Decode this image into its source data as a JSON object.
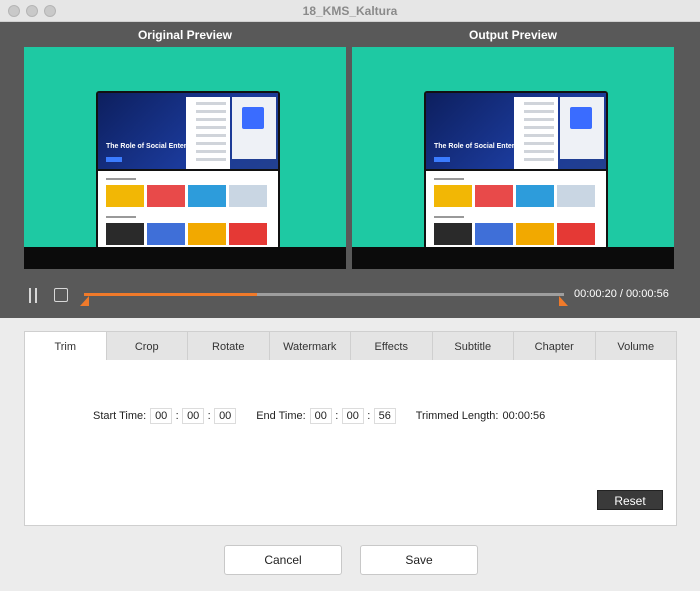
{
  "window": {
    "title": "18_KMS_Kaltura"
  },
  "preview": {
    "original_title": "Original Preview",
    "output_title": "Output  Preview",
    "video_headline": "The Role of Social Enterprise"
  },
  "playback": {
    "timecode": "00:00:20 / 00:00:56",
    "progress": 0.36
  },
  "tabs": [
    {
      "label": "Trim",
      "active": true
    },
    {
      "label": "Crop"
    },
    {
      "label": "Rotate"
    },
    {
      "label": "Watermark"
    },
    {
      "label": "Effects"
    },
    {
      "label": "Subtitle"
    },
    {
      "label": "Chapter"
    },
    {
      "label": "Volume"
    }
  ],
  "trim": {
    "start_label": "Start Time:",
    "start": [
      "00",
      "00",
      "00"
    ],
    "end_label": "End Time:",
    "end": [
      "00",
      "00",
      "56"
    ],
    "length_label": "Trimmed Length:",
    "length": "00:00:56",
    "reset_label": "Reset"
  },
  "footer": {
    "cancel_label": "Cancel",
    "save_label": "Save"
  },
  "colors": {
    "accent": "#f07a2a",
    "preview_bg": "#595959",
    "video_green": "#1ec9a3"
  }
}
